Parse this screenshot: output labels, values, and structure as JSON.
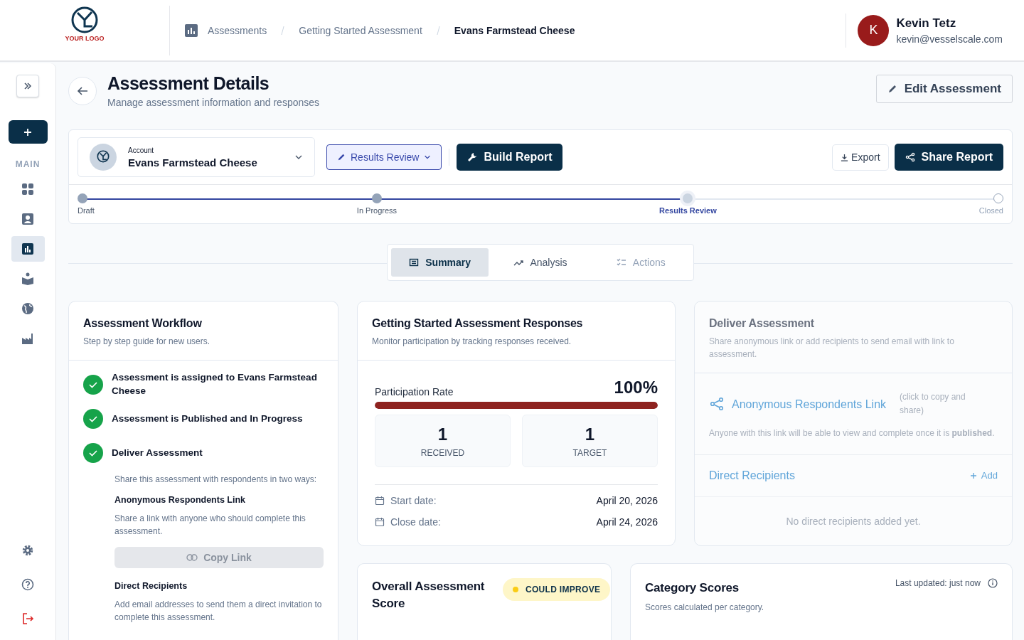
{
  "logo": {
    "text": "YOUR LOGO"
  },
  "breadcrumb": [
    {
      "label": "Assessments",
      "current": false
    },
    {
      "label": "Getting Started Assessment",
      "current": false
    },
    {
      "label": "Evans Farmstead Cheese",
      "current": true
    }
  ],
  "user": {
    "initial": "K",
    "name": "Kevin Tetz",
    "email": "kevin@vesselscale.com"
  },
  "sidebar": {
    "section": "MAIN",
    "items": [
      {
        "selected": false
      },
      {
        "selected": false
      },
      {
        "selected": true
      },
      {
        "selected": false
      },
      {
        "selected": false
      },
      {
        "selected": false
      }
    ]
  },
  "page": {
    "title": "Assessment Details",
    "subtitle": "Manage assessment information and responses",
    "edit_button": "Edit Assessment"
  },
  "toolbar": {
    "account_label": "Account",
    "account_name": "Evans Farmstead Cheese",
    "status_button": "Results Review",
    "build_button": "Build Report",
    "export_button": "Export",
    "share_button": "Share Report"
  },
  "stepper": [
    {
      "label": "Draft",
      "completed": true,
      "selected": false
    },
    {
      "label": "In Progress",
      "completed": true,
      "selected": false
    },
    {
      "label": "Results Review",
      "completed": false,
      "selected": true
    },
    {
      "label": "Closed",
      "completed": false,
      "selected": false
    }
  ],
  "tabs": [
    {
      "label": "Summary",
      "selected": true,
      "disabled": false
    },
    {
      "label": "Analysis",
      "selected": false,
      "disabled": false
    },
    {
      "label": "Actions",
      "selected": false,
      "disabled": true
    }
  ],
  "workflow": {
    "title": "Assessment Workflow",
    "subtitle": "Step by step guide for new users.",
    "steps": [
      {
        "label": "Assessment is assigned to Evans Farmstead Cheese",
        "checked": true
      },
      {
        "label": "Assessment is Published and In Progress",
        "checked": true
      },
      {
        "label": "Deliver Assessment",
        "checked": true
      }
    ],
    "intro": "Share this assessment with respondents in two ways:",
    "link_title": "Anonymous Respondents Link",
    "link_text": "Share a link with anyone who should complete this assessment.",
    "copy_button": "Copy Link",
    "copy_disabled": true,
    "direct_title": "Direct Recipients",
    "direct_text": "Add email addresses to send them a direct invitation to complete this assessment."
  },
  "responses": {
    "title": "Getting Started Assessment Responses",
    "subtitle": "Monitor participation by tracking responses received.",
    "rate_label": "Participation Rate",
    "rate_value": "100%",
    "level": 1,
    "stats": [
      {
        "value": "1",
        "label": "RECEIVED"
      },
      {
        "value": "1",
        "label": "TARGET"
      }
    ],
    "dates": [
      {
        "label": "Start date:",
        "value": "April 20, 2026"
      },
      {
        "label": "Close date:",
        "value": "April 24, 2026"
      }
    ]
  },
  "deliver": {
    "title": "Deliver Assessment",
    "subtitle": "Share anonymous link or add recipients to send email with link to assessment.",
    "link_title": "Anonymous Respondents Link",
    "link_hint": "(click to copy and share)",
    "link_note": "Anyone with this link will be able to view and complete once it is **published**.",
    "recipients_title": "Direct Recipients",
    "add_button": "Add",
    "empty": "No direct recipients added yet."
  },
  "overall": {
    "title": "Overall Assessment Score",
    "badge": "COULD IMPROVE"
  },
  "category": {
    "title": "Category Scores",
    "subtitle": "Scores calculated per category.",
    "updated": "Last updated: just now"
  }
}
